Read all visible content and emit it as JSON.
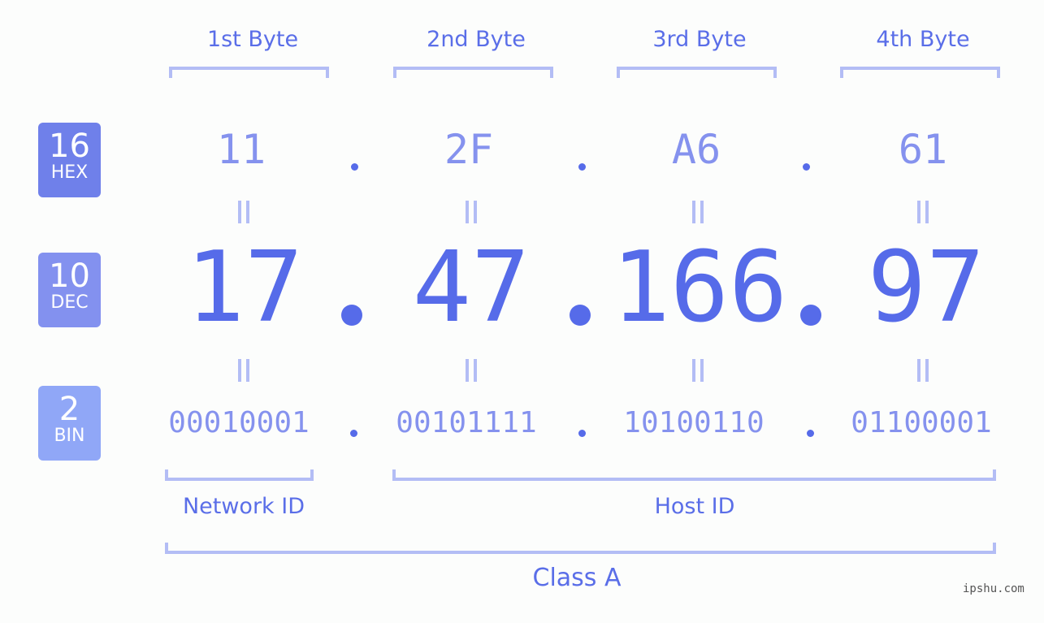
{
  "byte_headers": [
    "1st Byte",
    "2nd Byte",
    "3rd Byte",
    "4th Byte"
  ],
  "badges": [
    {
      "number": "16",
      "label": "HEX",
      "color": "#6f80ea"
    },
    {
      "number": "10",
      "label": "DEC",
      "color": "#8391ef"
    },
    {
      "number": "2",
      "label": "BIN",
      "color": "#90a7f7"
    }
  ],
  "ip": {
    "hex": [
      "11",
      "2F",
      "A6",
      "61"
    ],
    "dec": [
      "17",
      "47",
      "166",
      "97"
    ],
    "bin": [
      "00010001",
      "00101111",
      "10100110",
      "01100001"
    ],
    "separator": "."
  },
  "sections": {
    "network_id": "Network ID",
    "host_id": "Host ID",
    "class": "Class A"
  },
  "watermark": "ipshu.com",
  "colors": {
    "accent": "#566be9",
    "light_accent": "#8592ee",
    "bracket": "#b3bdf5"
  }
}
